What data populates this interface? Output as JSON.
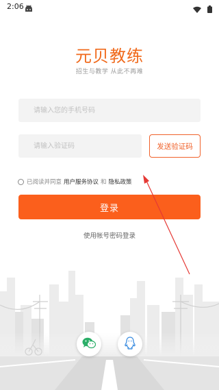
{
  "status_bar": {
    "time": "2:06"
  },
  "app": {
    "title": "元贝教练",
    "subtitle": "招生与教学  从此不再难"
  },
  "form": {
    "phone_placeholder": "请输入您的手机号码",
    "code_placeholder": "请输入验证码",
    "send_code_label": "发送验证码"
  },
  "agreement": {
    "prefix": "已阅读并同意",
    "user_agreement": "用户服务协议",
    "conjunction": "和",
    "privacy_policy": "隐私政策"
  },
  "login_label": "登录",
  "password_login_label": "使用帐号密码登录",
  "social_login": [
    {
      "icon": "wechat-icon",
      "color": "#2aae67"
    },
    {
      "icon": "qq-icon",
      "color": "#3b8de0"
    }
  ],
  "colors": {
    "brand": "#f06a1c",
    "login_button": "#fb5f1c",
    "annotation_arrow": "#e53935"
  }
}
